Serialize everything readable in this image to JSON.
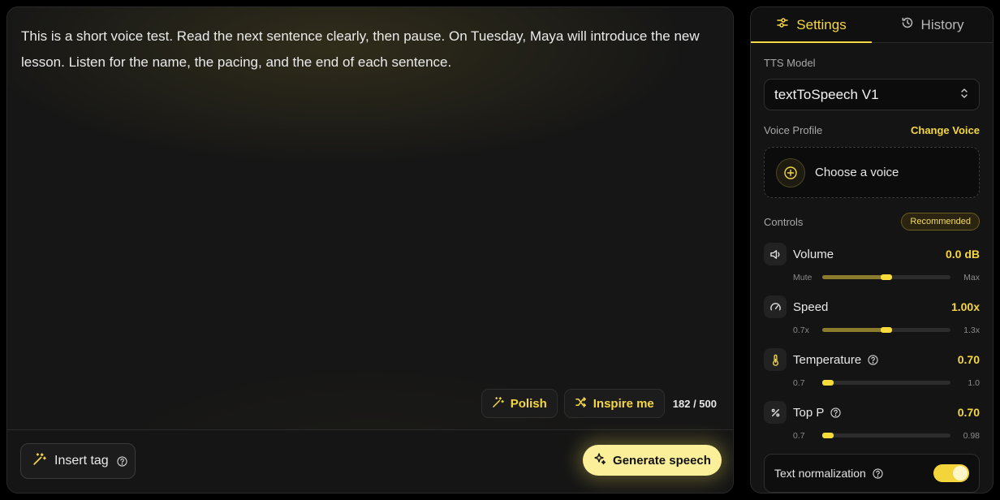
{
  "editor": {
    "text": "This is a short voice test. Read the next sentence clearly, then pause. On Tuesday, Maya will introduce the new lesson. Listen for the name, the pacing, and the end of each sentence.",
    "polish_label": "Polish",
    "inspire_label": "Inspire me",
    "char_count": "182 / 500",
    "insert_tag_label": "Insert tag",
    "generate_label": "Generate speech"
  },
  "panel": {
    "tabs": [
      {
        "label": "Settings",
        "icon": "sliders-icon",
        "active": true
      },
      {
        "label": "History",
        "icon": "history-icon",
        "active": false
      }
    ],
    "tts_model_label": "TTS Model",
    "tts_model_value": "textToSpeech V1",
    "voice_profile_label": "Voice Profile",
    "change_voice_label": "Change Voice",
    "choose_voice_label": "Choose a voice",
    "controls_label": "Controls",
    "recommended_label": "Recommended",
    "controls": [
      {
        "name": "Volume",
        "icon": "speaker-icon",
        "value": "0.0 dB",
        "min": "Mute",
        "max": "Max",
        "fraction": 0.5
      },
      {
        "name": "Speed",
        "icon": "gauge-icon",
        "value": "1.00x",
        "min": "0.7x",
        "max": "1.3x",
        "fraction": 0.5
      },
      {
        "name": "Temperature",
        "icon": "thermometer-icon",
        "value": "0.70",
        "min": "0.7",
        "max": "1.0",
        "fraction": 0.0
      },
      {
        "name": "Top P",
        "icon": "percent-icon",
        "value": "0.70",
        "min": "0.7",
        "max": "0.98",
        "fraction": 0.0
      }
    ],
    "text_normalization_label": "Text normalization",
    "text_normalization_on": true
  },
  "colors": {
    "accent": "#f4d743",
    "generate_bg": "#fbef9a"
  }
}
